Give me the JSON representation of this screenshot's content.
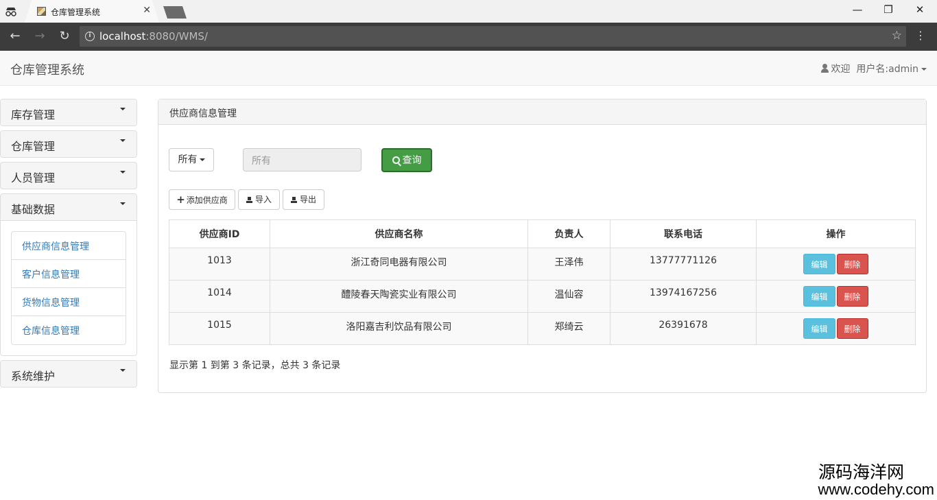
{
  "browser": {
    "tab_title": "仓库管理系统",
    "tab_close": "✕",
    "url_host": "localhost",
    "url_rest": ":8080/WMS/",
    "win_minimize": "—",
    "win_restore": "❐",
    "win_close": "✕"
  },
  "app": {
    "brand": "仓库管理系统",
    "welcome": "欢迎",
    "username": "用户名:admin"
  },
  "sidebar": {
    "sections": [
      {
        "label": "库存管理"
      },
      {
        "label": "仓库管理"
      },
      {
        "label": "人员管理"
      },
      {
        "label": "基础数据"
      },
      {
        "label": "系统维护"
      }
    ],
    "sub_items": [
      {
        "label": "供应商信息管理"
      },
      {
        "label": "客户信息管理"
      },
      {
        "label": "货物信息管理"
      },
      {
        "label": "仓库信息管理"
      }
    ]
  },
  "main": {
    "title": "供应商信息管理",
    "filter_label": "所有",
    "search_placeholder": "所有",
    "query_label": "查询",
    "add_label": "添加供应商",
    "import_label": "导入",
    "export_label": "导出",
    "columns": [
      "供应商ID",
      "供应商名称",
      "负责人",
      "联系电话",
      "操作"
    ],
    "rows": [
      {
        "id": "1013",
        "name": "浙江奇同电器有限公司",
        "person": "王泽伟",
        "phone": "13777771126"
      },
      {
        "id": "1014",
        "name": "醴陵春天陶瓷实业有限公司",
        "person": "温仙容",
        "phone": "13974167256"
      },
      {
        "id": "1015",
        "name": "洛阳嘉吉利饮品有限公司",
        "person": "郑绮云",
        "phone": "26391678"
      }
    ],
    "edit_label": "编辑",
    "delete_label": "删除",
    "pagination_info": "显示第 1 到第 3 条记录，总共 3 条记录"
  },
  "watermark": {
    "line1": "源码海洋网",
    "line2": "www.codehy.com"
  }
}
